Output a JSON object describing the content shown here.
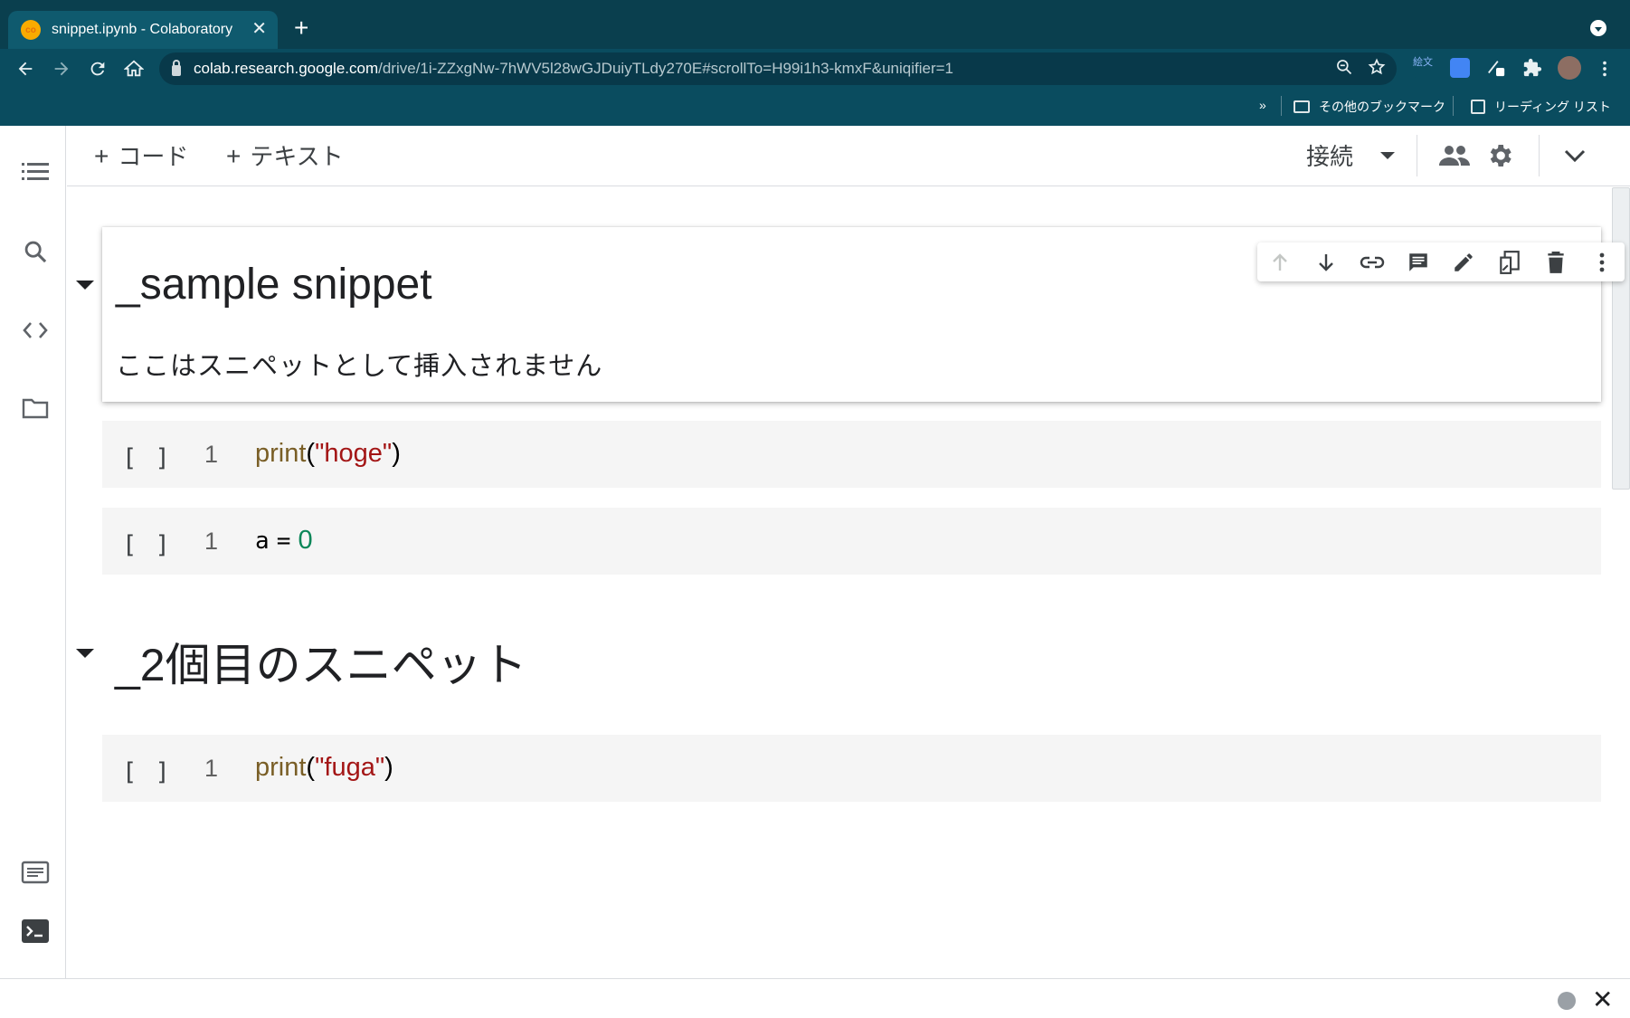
{
  "browser": {
    "tab_title": "snippet.ipynb - Colaboratory",
    "tab_close": "✕",
    "new_tab": "+",
    "url_host": "colab.research.google.com",
    "url_path": "/drive/1i-ZZxgNw-7hWV5l28wGJDuiyTLdy270E#scrollTo=H99i1h3-kmxF&uniqifier=1",
    "bookmarks_overflow": "»",
    "other_bookmarks": "その他のブックマーク",
    "reading_list": "リーディング リスト",
    "extension_label": "絵文"
  },
  "toolbar": {
    "add_code": "コード",
    "add_text": "テキスト",
    "plus": "+",
    "connect": "接続"
  },
  "notebook": {
    "section1": {
      "heading": "_sample snippet",
      "paragraph": "ここはスニペットとして挿入されません"
    },
    "code_cells": [
      {
        "bracket": "[ ]",
        "line": "1",
        "fn": "print",
        "open": "(",
        "str": "\"hoge\"",
        "close": ")"
      },
      {
        "bracket": "[ ]",
        "line": "1",
        "var": "a",
        "op": "=",
        "num": "0"
      }
    ],
    "section2": {
      "heading": "_2個目のスニペット"
    },
    "code_cell3": {
      "bracket": "[ ]",
      "line": "1",
      "fn": "print",
      "open": "(",
      "str": "\"fuga\"",
      "close": ")"
    }
  },
  "statusbar": {
    "close": "✕"
  },
  "colors": {
    "chrome_bg": "#0a4c5f",
    "tabstrip_bg": "#0a3f4e",
    "code_bg": "#f5f5f5",
    "string": "#a31515",
    "function": "#795e26",
    "number": "#098658"
  }
}
